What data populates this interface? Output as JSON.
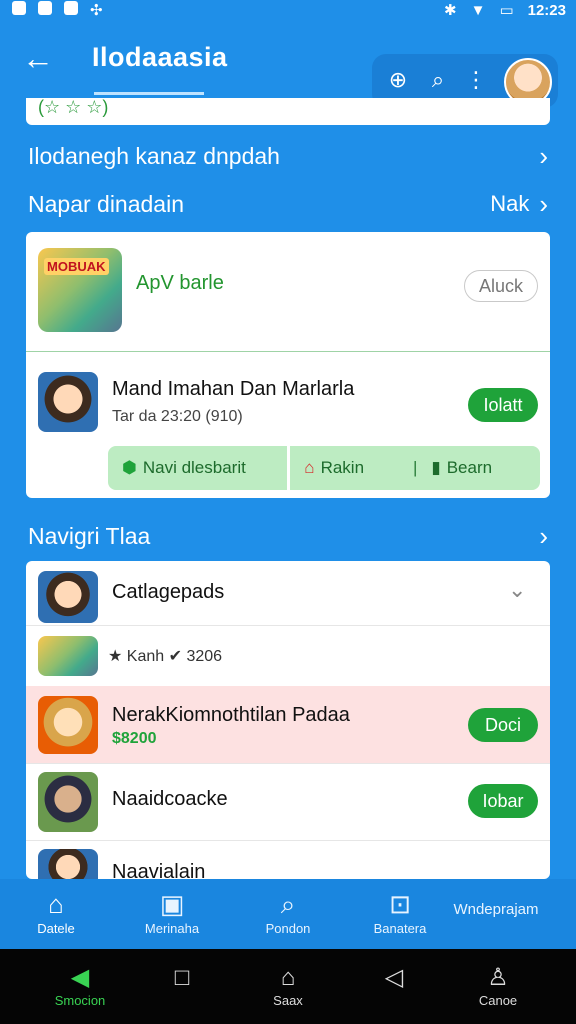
{
  "status": {
    "time": "12:23",
    "bluetooth_icon": "bluetooth-icon",
    "wifi_icon": "wifi-icon",
    "battery_icon": "battery-icon"
  },
  "appbar": {
    "back_icon": "arrow-left-icon",
    "title": "Ilodaaasia"
  },
  "partial_card_text": "(☆ ☆ ☆)",
  "section1": {
    "label": "Ilodanegh kanaz dnpdah"
  },
  "section2": {
    "label": "Napar dinadain",
    "more": "Nak"
  },
  "card1": {
    "app_title": "ApV barle",
    "app_thumb_label": "MOBUAK",
    "app_button": "Aluck",
    "person_name": "Mand Imahan Dan Marlarla",
    "person_sub": "Tar da 23:20  (910)",
    "person_button": "Iolatt",
    "actions": [
      {
        "label": "Navi dlesbarit",
        "icon": "shield-icon"
      },
      {
        "label": "Rakin",
        "icon": "home-icon"
      },
      {
        "label": "Bearn",
        "icon": "bookmark-icon"
      }
    ]
  },
  "section3": {
    "label": "Navigri Tlaa"
  },
  "list": [
    {
      "name": "Catlagepads",
      "sub": "",
      "button": ""
    },
    {
      "name": "",
      "sub": "★ Kanh  ✔ 3206",
      "button": ""
    },
    {
      "name": "NerakKiomnothtilan Padaa",
      "sub": "$8200",
      "button": "Doci"
    },
    {
      "name": "Naaidcoacke",
      "sub": "",
      "button": "Iobar"
    },
    {
      "name": "Naavialain",
      "sub": "",
      "button": ""
    }
  ],
  "bottomnav": [
    {
      "label": "Datele",
      "icon": "home-icon"
    },
    {
      "label": "Merinaha",
      "icon": "book-icon"
    },
    {
      "label": "Pondon",
      "icon": "search-icon"
    },
    {
      "label": "Banatera",
      "icon": "briefcase-icon"
    },
    {
      "label": "Wndeprajam",
      "icon": ""
    }
  ],
  "sysbar": [
    {
      "label": "Smocion",
      "icon": "triangle-icon"
    },
    {
      "label": "",
      "icon": "square-icon"
    },
    {
      "label": "Saax",
      "icon": "home-outline-icon"
    },
    {
      "label": "",
      "icon": "back-triangle-icon"
    },
    {
      "label": "Canoe",
      "icon": "person-icon"
    }
  ]
}
